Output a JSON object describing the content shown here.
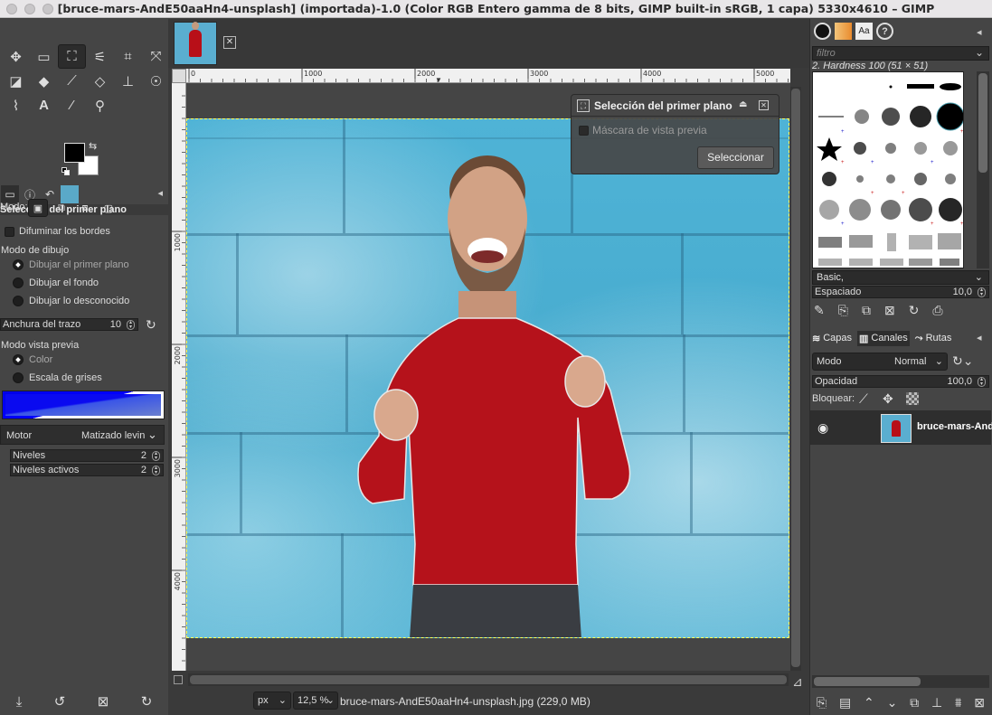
{
  "window": {
    "title": "[bruce-mars-AndE50aaHn4-unsplash] (importada)-1.0 (Color RGB Entero gamma de 8 bits, GIMP built-in sRGB, 1 capa) 5330x4610 – GIMP"
  },
  "toolbox": {
    "tool_icons": [
      "move-icon",
      "rect-select-icon",
      "foreground-select-icon",
      "fuzzy-select-icon",
      "crop-icon",
      "warp-icon",
      "bucket-fill-icon",
      "paint-icon",
      "brush-icon",
      "eraser-icon",
      "clone-icon",
      "smudge-icon",
      "path-icon",
      "text-icon",
      "color-picker-icon",
      "zoom-icon"
    ]
  },
  "tool_options": {
    "title": "Selección del primer plano",
    "mode_label": "Modo:",
    "feather_label": "Difuminar los bordes",
    "draw_mode_label": "Modo de dibujo",
    "draw_foreground": "Dibujar el primer plano",
    "draw_background": "Dibujar el fondo",
    "draw_unknown": "Dibujar lo desconocido",
    "stroke_width_label": "Anchura del trazo",
    "stroke_width_value": "10",
    "preview_mode_label": "Modo vista previa",
    "preview_color": "Color",
    "preview_grayscale": "Escala de grises",
    "engine_label": "Motor",
    "engine_value": "Matizado levin",
    "levels_label": "Niveles",
    "levels_value": "2",
    "active_levels_label": "Niveles activos",
    "active_levels_value": "2"
  },
  "rulers": {
    "h_labels": [
      "0",
      "1000",
      "2000",
      "3000",
      "4000",
      "5000"
    ],
    "v_labels": [
      "1000",
      "2000",
      "3000",
      "4000"
    ]
  },
  "fg_select_dialog": {
    "title": "Selección del primer plano",
    "preview_mask_label": "Máscara de vista previa",
    "select_button": "Seleccionar"
  },
  "statusbar": {
    "unit": "px",
    "zoom": "12,5 %",
    "file_info": "bruce-mars-AndE50aaHn4-unsplash.jpg (229,0 MB)"
  },
  "brushes": {
    "filter_placeholder": "filtro",
    "current_brush": "2. Hardness 100 (51 × 51)",
    "preset": "Basic,",
    "spacing_label": "Espaciado",
    "spacing_value": "10,0"
  },
  "layers": {
    "tabs": [
      "Capas",
      "Canales",
      "Rutas"
    ],
    "mode_label": "Modo",
    "mode_value": "Normal",
    "opacity_label": "Opacidad",
    "opacity_value": "100,0",
    "lock_label": "Bloquear:",
    "layer_name": "bruce-mars-AndE"
  }
}
